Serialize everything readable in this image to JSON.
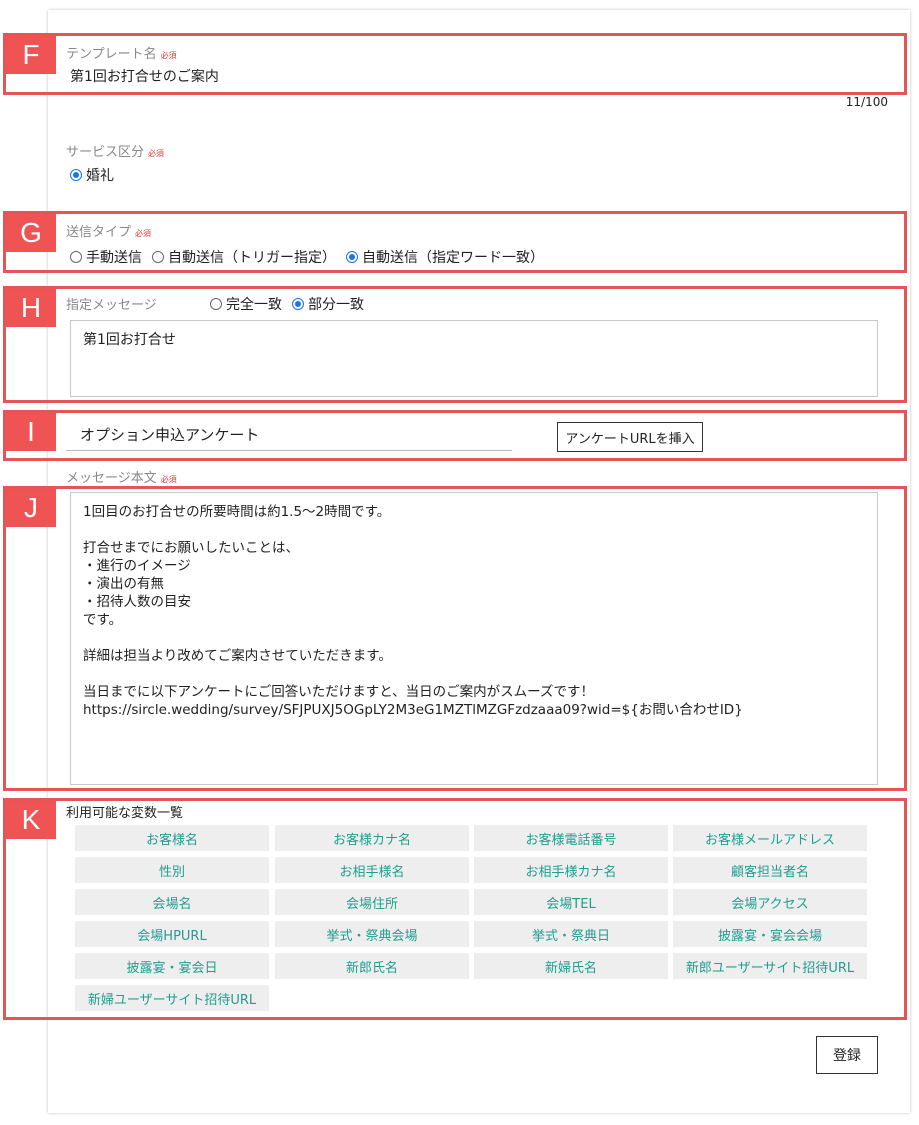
{
  "tags": {
    "F": "F",
    "G": "G",
    "H": "H",
    "I": "I",
    "J": "J",
    "K": "K"
  },
  "required_mark": "必須",
  "template_name": {
    "label": "テンプレート名",
    "value": "第1回お打合せのご案内",
    "counter": "11/100"
  },
  "service": {
    "label": "サービス区分",
    "options": [
      {
        "label": "婚礼",
        "checked": true
      }
    ]
  },
  "send_type": {
    "label": "送信タイプ",
    "options": [
      {
        "label": "手動送信",
        "checked": false
      },
      {
        "label": "自動送信（トリガー指定）",
        "checked": false
      },
      {
        "label": "自動送信（指定ワード一致）",
        "checked": true
      }
    ]
  },
  "keyword": {
    "label": "指定メッセージ",
    "options": [
      {
        "label": "完全一致",
        "checked": false
      },
      {
        "label": "部分一致",
        "checked": true
      }
    ],
    "value": "第1回お打合せ"
  },
  "survey": {
    "value": "オプション申込アンケート",
    "insert_button": "アンケートURLを挿入"
  },
  "message": {
    "label": "メッセージ本文",
    "body": "1回目のお打合せの所要時間は約1.5～2時間です。\n\n打合せまでにお願いしたいことは、\n・進行のイメージ\n・演出の有無\n・招待人数の目安\nです。\n\n詳細は担当より改めてご案内させていただきます。\n\n当日までに以下アンケートにご回答いただけますと、当日のご案内がスムーズです！\nhttps://sircle.wedding/survey/SFJPUXJ5OGpLY2M3eG1MZTlMZGFzdzaaa09?wid=${お問い合わせID}"
  },
  "variables": {
    "title": "利用可能な変数一覧",
    "items": [
      "お客様名",
      "お客様カナ名",
      "お客様電話番号",
      "お客様メールアドレス",
      "性別",
      "お相手様名",
      "お相手様カナ名",
      "顧客担当者名",
      "会場名",
      "会場住所",
      "会場TEL",
      "会場アクセス",
      "会場HPURL",
      "挙式・祭典会場",
      "挙式・祭典日",
      "披露宴・宴会会場",
      "披露宴・宴会日",
      "新郎氏名",
      "新婦氏名",
      "新郎ユーザーサイト招待URL",
      "新婦ユーザーサイト招待URL"
    ]
  },
  "submit_button": "登録",
  "colors": {
    "annotation": "#e45555",
    "radio_on": "#1a73e8",
    "variable_text": "#1e9e8f"
  }
}
